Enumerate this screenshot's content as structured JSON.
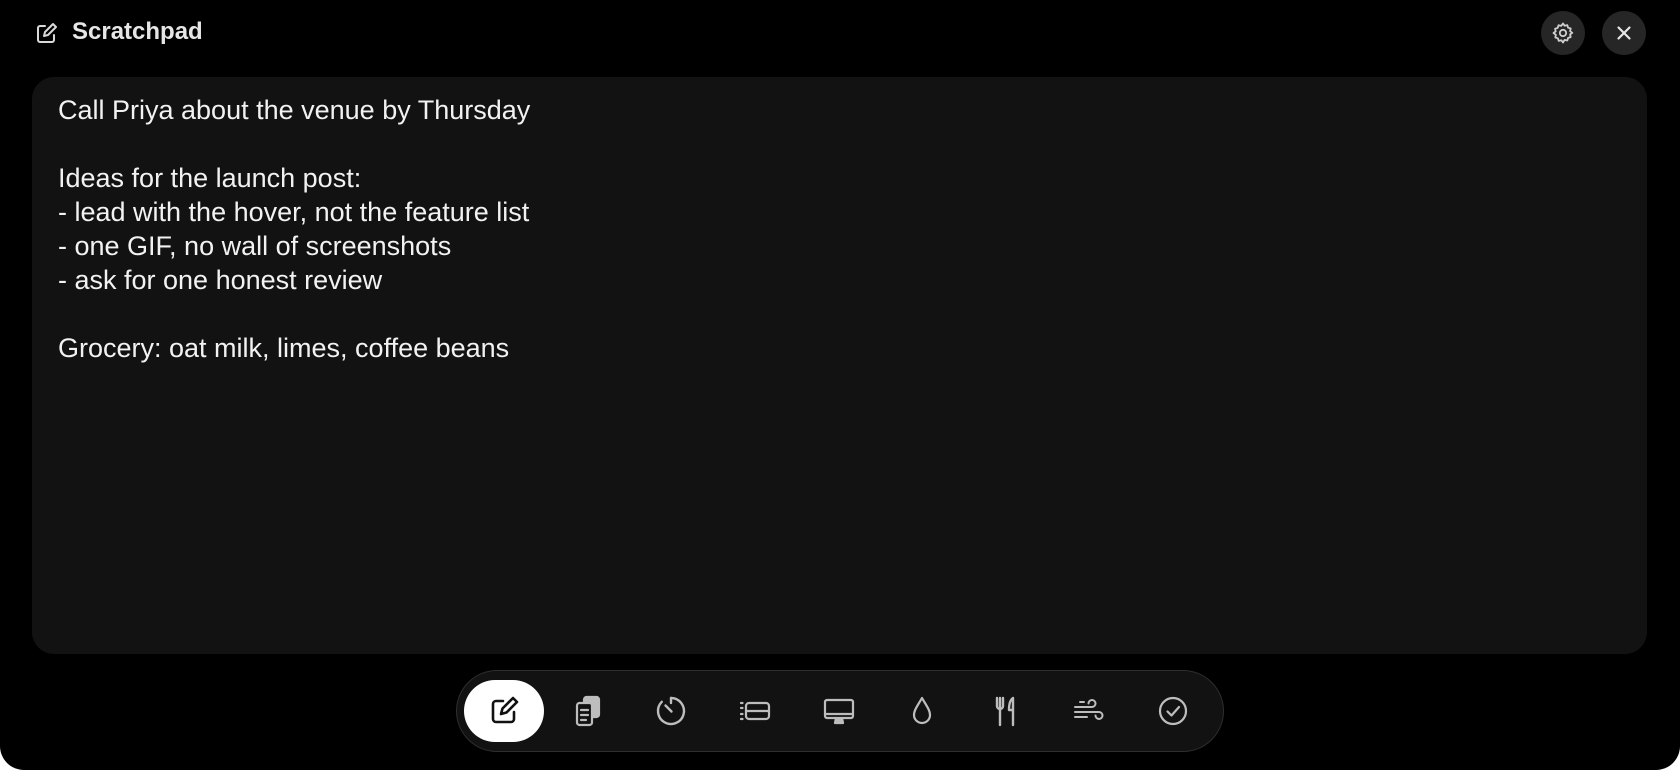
{
  "window": {
    "title": "Scratchpad",
    "title_icon": "compose-icon",
    "actions": [
      {
        "name": "settings",
        "icon": "gear-icon"
      },
      {
        "name": "close",
        "icon": "close-icon"
      }
    ]
  },
  "note": {
    "content": "Call Priya about the venue by Thursday\n\nIdeas for the launch post:\n- lead with the hover, not the feature list\n- one GIF, no wall of screenshots\n- ask for one honest review\n\nGrocery: oat milk, limes, coffee beans"
  },
  "dock": {
    "active_index": 0,
    "items": [
      {
        "name": "scratchpad",
        "icon": "compose-icon"
      },
      {
        "name": "clipboard",
        "icon": "clipboard-icon"
      },
      {
        "name": "timer",
        "icon": "timer-icon"
      },
      {
        "name": "list",
        "icon": "list-icon"
      },
      {
        "name": "display",
        "icon": "monitor-icon"
      },
      {
        "name": "water",
        "icon": "droplet-icon"
      },
      {
        "name": "food",
        "icon": "fork-knife-icon"
      },
      {
        "name": "breathe",
        "icon": "wind-icon"
      },
      {
        "name": "tasks",
        "icon": "checkmark-circle-icon"
      }
    ]
  },
  "colors": {
    "window_bg": "#000000",
    "panel_bg": "#121212",
    "text": "#f2f2f2",
    "icon": "#bdbdbd",
    "active_pill": "#ffffff"
  }
}
